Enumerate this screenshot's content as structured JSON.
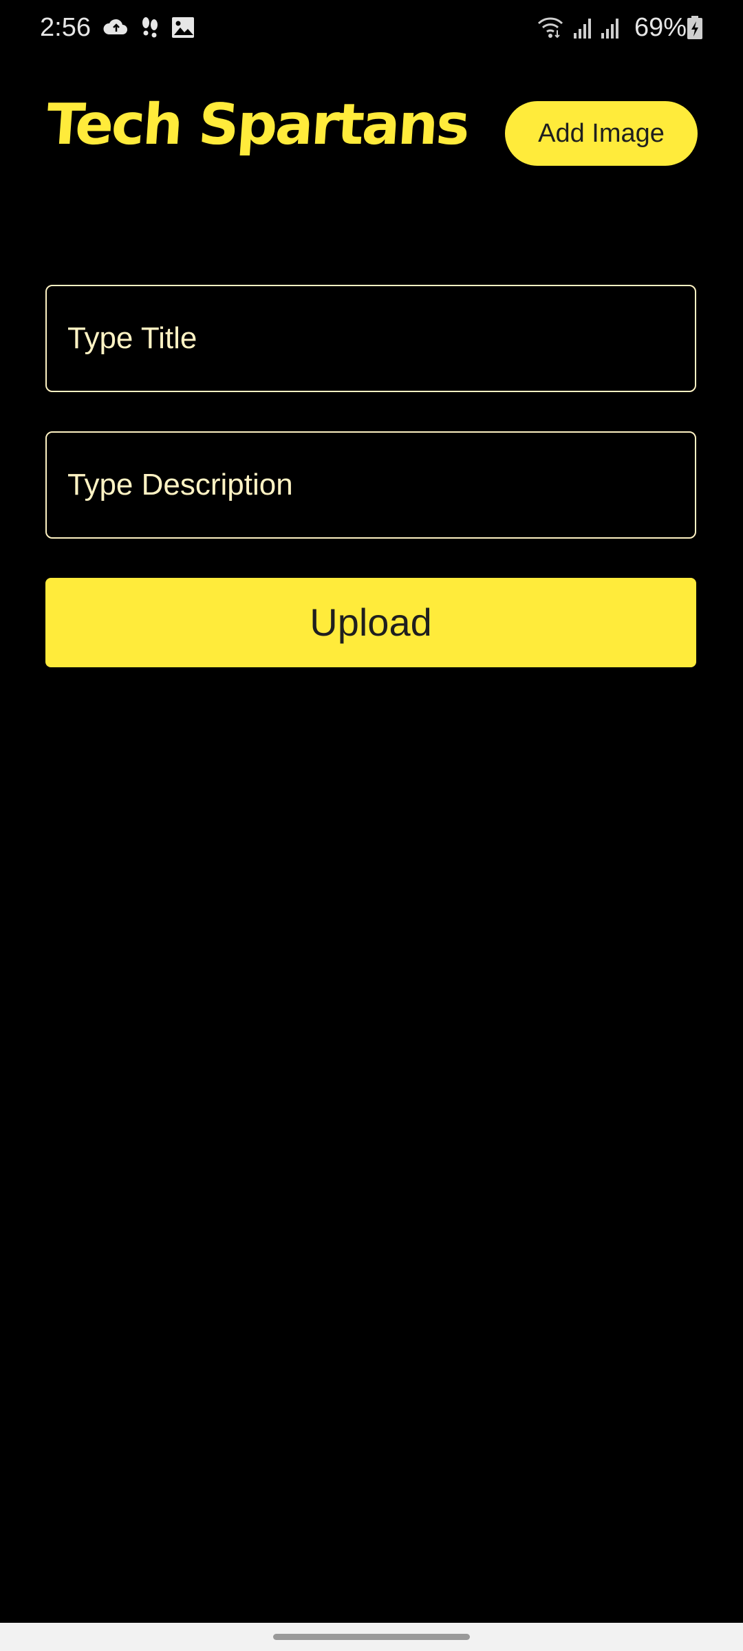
{
  "status_bar": {
    "time": "2:56",
    "battery": "69%",
    "icons": [
      "cloud-sync-icon",
      "footsteps-icon",
      "image-icon",
      "wifi-icon",
      "signal-icon",
      "signal-icon",
      "battery-charging-icon"
    ]
  },
  "header": {
    "title": "Tech Spartans",
    "add_image_label": "Add Image"
  },
  "form": {
    "title_placeholder": "Type Title",
    "title_value": "",
    "description_placeholder": "Type Description",
    "description_value": "",
    "upload_label": "Upload"
  },
  "colors": {
    "background": "#000000",
    "accent": "#ffeb3b",
    "field_border": "#fff3c4",
    "button_text": "#1f1f1f",
    "nav_bar": "#f2f2f2"
  }
}
